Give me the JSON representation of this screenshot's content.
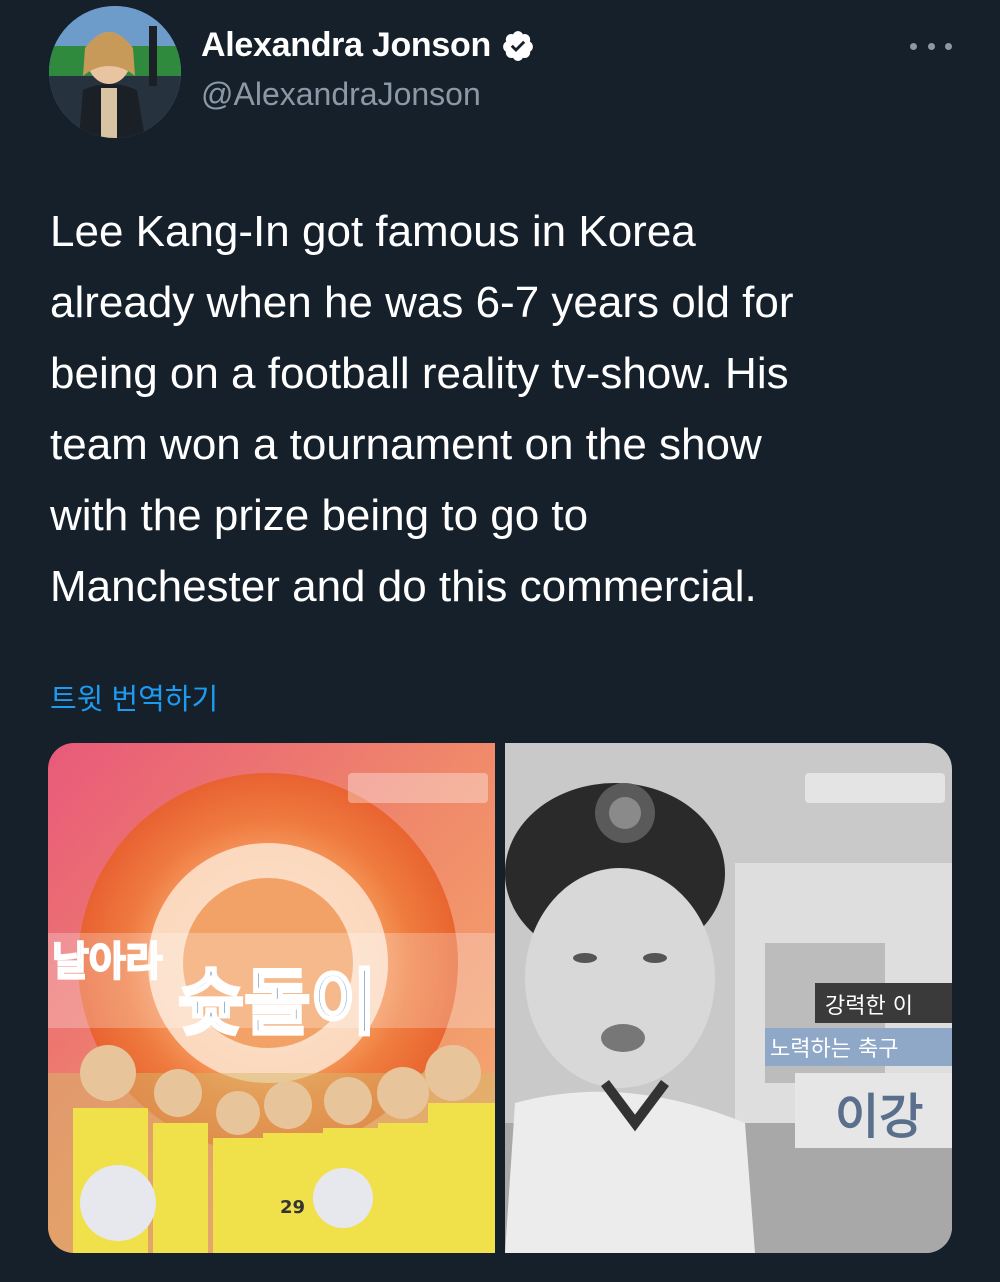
{
  "author": {
    "display_name": "Alexandra Jonson",
    "handle": "@AlexandraJonson",
    "verified": true,
    "avatar_icon": "profile-photo"
  },
  "tweet": {
    "lines": [
      "Lee Kang-In got famous in Korea",
      "already when he was 6-7 years old for",
      "being on a football reality tv-show. His",
      "team won a tournament on the show",
      "with the prize being to go to",
      "Manchester and do this commercial."
    ],
    "translate_label": "트윗 번역하기"
  },
  "media": {
    "left_image": {
      "overlay_title": "슛돌이",
      "overlay_prefix": "날아라",
      "jersey_number": "29"
    },
    "right_image": {
      "caption_line_1": "강력한 이",
      "caption_line_2": "노력하는 축구",
      "caption_name": "이강"
    }
  },
  "colors": {
    "background": "#15202b",
    "text": "#ffffff",
    "secondary_text": "#8b98a5",
    "link": "#1d9bf0",
    "verified_badge": "#ffffff"
  },
  "menu": {
    "icon": "more-options-icon"
  }
}
